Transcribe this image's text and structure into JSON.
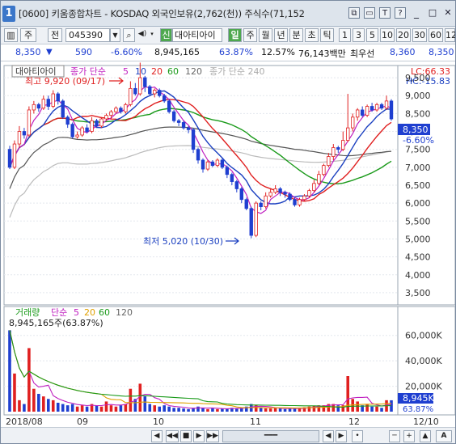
{
  "window": {
    "badge": "1",
    "title": "[0600] 키움종합차트 - KOSDAQ 외국인보유(2,762(천)) 주식수(71,152",
    "btn_restore": "⧉",
    "btn_min": "▭",
    "btn_t": "T",
    "btn_help": "?",
    "btn_close": "✕"
  },
  "toolbar": {
    "icon_chart": "▥",
    "market": "주",
    "code_prefix": "전",
    "code": "045390",
    "period_sel": "신",
    "stock_name": "대아티아이",
    "periods": [
      "일",
      "주",
      "월",
      "년",
      "분",
      "초",
      "틱"
    ],
    "intervals": [
      "1",
      "3",
      "5",
      "10",
      "20",
      "30",
      "60",
      "12"
    ]
  },
  "quote": {
    "price": "8,350",
    "arrow": "▼",
    "change": "590",
    "change_pct": "-6.60%",
    "volume": "8,945,165",
    "vol_ratio": "63.87%",
    "turnover_pct": "12.57%",
    "amount": "76,143백만",
    "ask_label": "최우선",
    "ask1": "8,360",
    "ask2": "8,350"
  },
  "price_pane": {
    "stock_label": "대아티아이",
    "ma_label": "종가 단순",
    "ma_periods": [
      "5",
      "10",
      "20",
      "60",
      "120"
    ],
    "ma240_label": "종가 단순 240",
    "lc": "LC:66.33",
    "hc": "HC:-15.83",
    "high_note": "최고 9,920 (09/17)",
    "low_note": "최저 5,020 (10/30)",
    "y_ticks": [
      "9,500",
      "9,000",
      "8,500",
      "8,000",
      "7,500",
      "7,000",
      "6,500",
      "6,000",
      "5,500",
      "5,000",
      "4,500",
      "4,000",
      "3,500"
    ],
    "last_price": "8,350",
    "last_change": "-6.60%"
  },
  "volume_pane": {
    "label": "거래량",
    "ma_label": "단순",
    "ma_periods": [
      "5",
      "20",
      "60",
      "120"
    ],
    "info": "8,945,165주(63.87%)",
    "y_ticks": [
      "60,000K",
      "40,000K",
      "20,000K"
    ],
    "last_volume": "8,945K",
    "last_ratio": "63.87%"
  },
  "x_axis": {
    "labels": [
      "2018/08",
      "09",
      "10",
      "11",
      "12"
    ],
    "right_label": "12/10"
  },
  "bottombar": {
    "buttons": [
      "◀",
      "◀◀",
      "■",
      "▶",
      "▶▶",
      "━━━",
      "◀",
      "▶",
      "•",
      "─",
      "+",
      "▲"
    ]
  },
  "chart_data": [
    {
      "type": "candlestick",
      "y_range": [
        3250,
        9750
      ],
      "candles": [
        [
          7500,
          7000,
          7600,
          6950
        ],
        [
          7000,
          7650,
          7750,
          6950
        ],
        [
          7650,
          8000,
          8150,
          7550
        ],
        [
          8000,
          7900,
          8100,
          7800
        ],
        [
          7900,
          8600,
          8700,
          7850
        ],
        [
          8600,
          8750,
          8850,
          8500
        ],
        [
          8750,
          8650,
          8800,
          8550
        ],
        [
          8650,
          8900,
          9000,
          8600
        ],
        [
          8900,
          8700,
          9000,
          8600
        ],
        [
          8700,
          9050,
          9150,
          8650
        ],
        [
          9050,
          8850,
          9100,
          8750
        ],
        [
          8850,
          8400,
          8900,
          8350
        ],
        [
          8400,
          8200,
          8450,
          8100
        ],
        [
          8200,
          7850,
          8250,
          7800
        ],
        [
          7850,
          7900,
          8000,
          7800
        ],
        [
          7900,
          8100,
          8150,
          7850
        ],
        [
          8100,
          8000,
          8200,
          7950
        ],
        [
          8000,
          8300,
          8400,
          7950
        ],
        [
          8300,
          8150,
          8350,
          8100
        ],
        [
          8150,
          8350,
          8400,
          8100
        ],
        [
          8350,
          8450,
          8500,
          8300
        ],
        [
          8450,
          8550,
          8600,
          8350
        ],
        [
          8550,
          8650,
          8700,
          8500
        ],
        [
          8650,
          8550,
          8700,
          8500
        ],
        [
          8550,
          8750,
          8800,
          8500
        ],
        [
          8750,
          9200,
          9400,
          8700
        ],
        [
          9200,
          9050,
          9350,
          9000
        ],
        [
          9050,
          9500,
          9920,
          9000
        ],
        [
          9500,
          9250,
          9550,
          9100
        ],
        [
          9250,
          9050,
          9300,
          9000
        ],
        [
          9050,
          9150,
          9200,
          8950
        ],
        [
          9150,
          9000,
          9200,
          8950
        ],
        [
          9000,
          8850,
          9050,
          8800
        ],
        [
          8850,
          8550,
          8900,
          8500
        ],
        [
          8550,
          8300,
          8600,
          8250
        ],
        [
          8300,
          8250,
          8350,
          8150
        ],
        [
          8250,
          8100,
          8300,
          8050
        ],
        [
          8100,
          8050,
          8150,
          7950
        ],
        [
          8050,
          7500,
          8100,
          7400
        ],
        [
          7500,
          7200,
          7550,
          7100
        ],
        [
          7200,
          6950,
          7250,
          6850
        ],
        [
          6950,
          7150,
          7200,
          6900
        ],
        [
          7150,
          7050,
          7200,
          7000
        ],
        [
          7050,
          7200,
          7250,
          7000
        ],
        [
          7200,
          7000,
          7250,
          6950
        ],
        [
          7000,
          6800,
          7050,
          6700
        ],
        [
          6800,
          6600,
          6850,
          6500
        ],
        [
          6600,
          6400,
          6650,
          6300
        ],
        [
          6400,
          6100,
          6450,
          6000
        ],
        [
          6100,
          5850,
          6150,
          5800
        ],
        [
          5850,
          5100,
          5900,
          5020
        ],
        [
          5100,
          6000,
          6050,
          5050
        ],
        [
          6000,
          5900,
          6050,
          5800
        ],
        [
          5900,
          6200,
          6300,
          5850
        ],
        [
          6200,
          6300,
          6400,
          6150
        ],
        [
          6300,
          6400,
          6500,
          6250
        ],
        [
          6400,
          6300,
          6450,
          6200
        ],
        [
          6300,
          6250,
          6350,
          6150
        ],
        [
          6250,
          6100,
          6300,
          6050
        ],
        [
          6100,
          5950,
          6150,
          5900
        ],
        [
          5950,
          6100,
          6150,
          5900
        ],
        [
          6100,
          6200,
          6250,
          6050
        ],
        [
          6200,
          6350,
          6400,
          6150
        ],
        [
          6350,
          6550,
          6650,
          6300
        ],
        [
          6550,
          6800,
          6900,
          6500
        ],
        [
          6800,
          7050,
          7100,
          6750
        ],
        [
          7050,
          7300,
          7400,
          7000
        ],
        [
          7300,
          7550,
          7650,
          7200
        ],
        [
          7550,
          7500,
          7600,
          7400
        ],
        [
          7500,
          7750,
          8000,
          7450
        ],
        [
          7750,
          8100,
          9050,
          7700
        ],
        [
          8100,
          8400,
          8500,
          8000
        ],
        [
          8400,
          8600,
          8650,
          8300
        ],
        [
          8600,
          8450,
          8700,
          8400
        ],
        [
          8450,
          8700,
          8750,
          8400
        ],
        [
          8700,
          8600,
          8800,
          8550
        ],
        [
          8600,
          8750,
          8800,
          8550
        ],
        [
          8750,
          8650,
          8800,
          8600
        ],
        [
          8650,
          8850,
          9000,
          8600
        ],
        [
          8850,
          8350,
          8900,
          8300
        ]
      ]
    },
    {
      "type": "bar",
      "series_name": "거래량 (K)",
      "y_range": [
        0,
        70000
      ],
      "values": [
        64000,
        30000,
        9000,
        6000,
        50000,
        18000,
        14000,
        12000,
        10000,
        9000,
        7000,
        6000,
        5000,
        6000,
        4000,
        5000,
        4000,
        6000,
        5000,
        4000,
        8000,
        5000,
        4000,
        5000,
        6000,
        18000,
        10000,
        22000,
        12000,
        6000,
        5000,
        4000,
        5000,
        4000,
        3000,
        3000,
        2500,
        2000,
        3000,
        4000,
        3000,
        2000,
        2500,
        2000,
        2500,
        2500,
        3000,
        2500,
        3000,
        4000,
        6000,
        5000,
        3000,
        2500,
        2500,
        3000,
        2500,
        2000,
        2500,
        2500,
        3000,
        3500,
        4000,
        4500,
        5000,
        5000,
        6000,
        6000,
        5000,
        5000,
        28000,
        10000,
        8000,
        5000,
        6000,
        4000,
        4000,
        3000,
        9000,
        8945
      ]
    }
  ]
}
